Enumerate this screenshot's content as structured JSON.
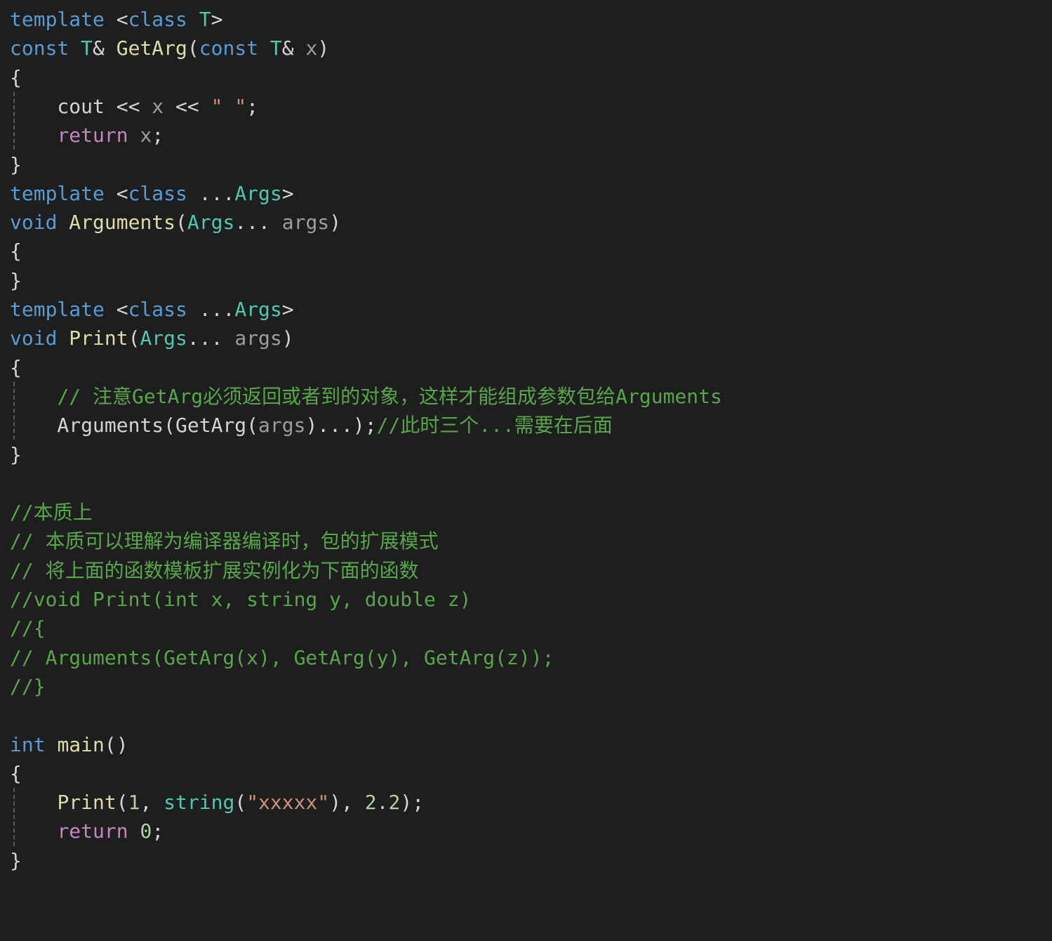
{
  "editor": {
    "colors": {
      "background": "#1e1e1e",
      "keyword": "#569cd6",
      "control": "#c586c0",
      "function": "#dcdcaa",
      "type": "#4ec9b0",
      "parameter": "#9cdcfe",
      "string": "#ce9178",
      "number": "#b5cea8",
      "comment": "#57a64a",
      "plain": "#d4d4d4"
    },
    "lines": [
      [
        {
          "t": "kw",
          "s": "template"
        },
        {
          "t": "plain",
          "s": " <"
        },
        {
          "t": "kw",
          "s": "class"
        },
        {
          "t": "plain",
          "s": " "
        },
        {
          "t": "type",
          "s": "T"
        },
        {
          "t": "plain",
          "s": ">"
        }
      ],
      [
        {
          "t": "kw",
          "s": "const"
        },
        {
          "t": "plain",
          "s": " "
        },
        {
          "t": "type",
          "s": "T"
        },
        {
          "t": "plain",
          "s": "& "
        },
        {
          "t": "fn",
          "s": "GetArg"
        },
        {
          "t": "plain",
          "s": "("
        },
        {
          "t": "kw",
          "s": "const"
        },
        {
          "t": "plain",
          "s": " "
        },
        {
          "t": "type",
          "s": "T"
        },
        {
          "t": "plain",
          "s": "& "
        },
        {
          "t": "param-dim",
          "s": "x"
        },
        {
          "t": "plain",
          "s": ")"
        }
      ],
      [
        {
          "t": "plain",
          "s": "{"
        }
      ],
      [
        {
          "t": "plain",
          "s": "    cout << "
        },
        {
          "t": "param-dim",
          "s": "x"
        },
        {
          "t": "plain",
          "s": " << "
        },
        {
          "t": "str",
          "s": "\" \""
        },
        {
          "t": "plain",
          "s": ";"
        }
      ],
      [
        {
          "t": "plain",
          "s": "    "
        },
        {
          "t": "ctrl",
          "s": "return"
        },
        {
          "t": "plain",
          "s": " "
        },
        {
          "t": "param-dim",
          "s": "x"
        },
        {
          "t": "plain",
          "s": ";"
        }
      ],
      [
        {
          "t": "plain",
          "s": "}"
        }
      ],
      [
        {
          "t": "kw",
          "s": "template"
        },
        {
          "t": "plain",
          "s": " <"
        },
        {
          "t": "kw",
          "s": "class"
        },
        {
          "t": "plain",
          "s": " ..."
        },
        {
          "t": "type",
          "s": "Args"
        },
        {
          "t": "plain",
          "s": ">"
        }
      ],
      [
        {
          "t": "kw",
          "s": "void"
        },
        {
          "t": "plain",
          "s": " "
        },
        {
          "t": "fn",
          "s": "Arguments"
        },
        {
          "t": "plain",
          "s": "("
        },
        {
          "t": "type",
          "s": "Args"
        },
        {
          "t": "plain",
          "s": "... "
        },
        {
          "t": "param-dim",
          "s": "args"
        },
        {
          "t": "plain",
          "s": ")"
        }
      ],
      [
        {
          "t": "plain",
          "s": "{"
        }
      ],
      [
        {
          "t": "plain",
          "s": "}"
        }
      ],
      [
        {
          "t": "kw",
          "s": "template"
        },
        {
          "t": "plain",
          "s": " <"
        },
        {
          "t": "kw",
          "s": "class"
        },
        {
          "t": "plain",
          "s": " ..."
        },
        {
          "t": "type",
          "s": "Args"
        },
        {
          "t": "plain",
          "s": ">"
        }
      ],
      [
        {
          "t": "kw",
          "s": "void"
        },
        {
          "t": "plain",
          "s": " "
        },
        {
          "t": "fn",
          "s": "Print"
        },
        {
          "t": "plain",
          "s": "("
        },
        {
          "t": "type",
          "s": "Args"
        },
        {
          "t": "plain",
          "s": "... "
        },
        {
          "t": "param-dim",
          "s": "args"
        },
        {
          "t": "plain",
          "s": ")"
        }
      ],
      [
        {
          "t": "plain",
          "s": "{"
        }
      ],
      [
        {
          "t": "plain",
          "s": "    "
        },
        {
          "t": "comment",
          "s": "// 注意GetArg必须返回或者到的对象，这样才能组成参数包给Arguments"
        }
      ],
      [
        {
          "t": "plain",
          "s": "    Arguments(GetArg("
        },
        {
          "t": "param-dim",
          "s": "args"
        },
        {
          "t": "plain",
          "s": ")...);"
        },
        {
          "t": "comment",
          "s": "//此时三个...需要在后面"
        }
      ],
      [
        {
          "t": "plain",
          "s": "}"
        }
      ],
      [],
      [
        {
          "t": "comment",
          "s": "//本质上"
        }
      ],
      [
        {
          "t": "comment",
          "s": "// 本质可以理解为编译器编译时，包的扩展模式"
        }
      ],
      [
        {
          "t": "comment",
          "s": "// 将上面的函数模板扩展实例化为下面的函数"
        }
      ],
      [
        {
          "t": "comment",
          "s": "//void Print(int x, string y, double z)"
        }
      ],
      [
        {
          "t": "comment",
          "s": "//{"
        }
      ],
      [
        {
          "t": "comment",
          "s": "// Arguments(GetArg(x), GetArg(y), GetArg(z));"
        }
      ],
      [
        {
          "t": "comment",
          "s": "//}"
        }
      ],
      [],
      [
        {
          "t": "kw",
          "s": "int"
        },
        {
          "t": "plain",
          "s": " "
        },
        {
          "t": "fn",
          "s": "main"
        },
        {
          "t": "plain",
          "s": "()"
        }
      ],
      [
        {
          "t": "plain",
          "s": "{"
        }
      ],
      [
        {
          "t": "plain",
          "s": "    "
        },
        {
          "t": "fn",
          "s": "Print"
        },
        {
          "t": "plain",
          "s": "("
        },
        {
          "t": "num",
          "s": "1"
        },
        {
          "t": "plain",
          "s": ", "
        },
        {
          "t": "type",
          "s": "string"
        },
        {
          "t": "plain",
          "s": "("
        },
        {
          "t": "str",
          "s": "\"xxxxx\""
        },
        {
          "t": "plain",
          "s": "), "
        },
        {
          "t": "num",
          "s": "2.2"
        },
        {
          "t": "plain",
          "s": ");"
        }
      ],
      [
        {
          "t": "plain",
          "s": "    "
        },
        {
          "t": "ctrl",
          "s": "return"
        },
        {
          "t": "plain",
          "s": " "
        },
        {
          "t": "num",
          "s": "0"
        },
        {
          "t": "plain",
          "s": ";"
        }
      ],
      [
        {
          "t": "plain",
          "s": "}"
        }
      ]
    ]
  }
}
